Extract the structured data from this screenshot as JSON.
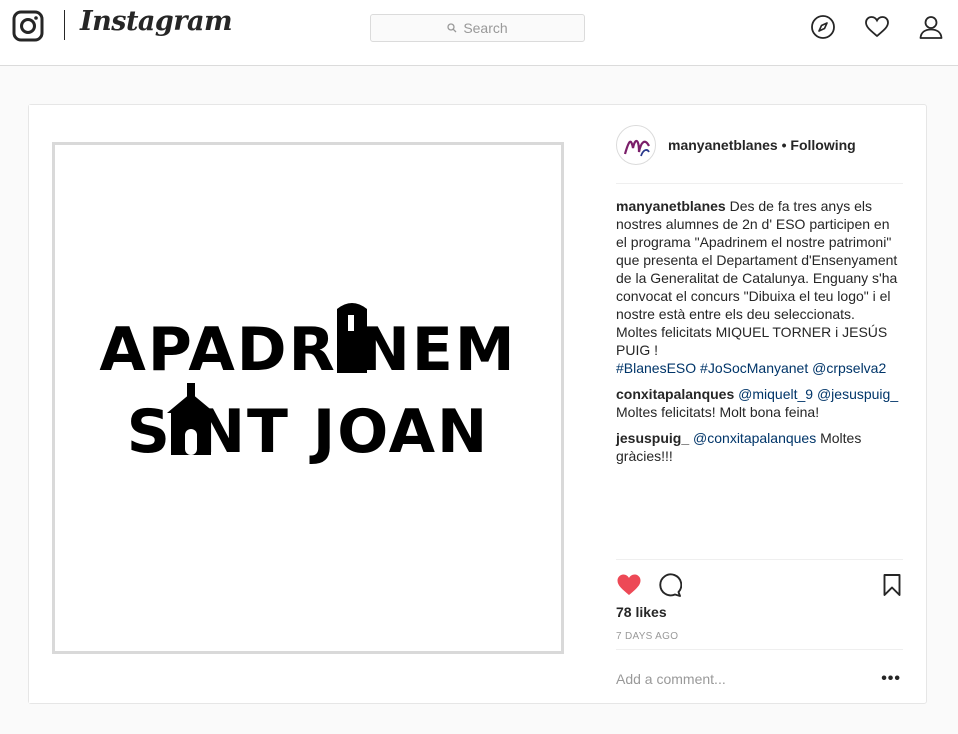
{
  "topbar": {
    "logo_icon": "instagram-camera-icon",
    "wordmark": "Instagram",
    "search_placeholder": "Search",
    "search_icon": "search-icon",
    "nav_icons": [
      "compass-icon",
      "heart-icon",
      "profile-icon"
    ]
  },
  "post": {
    "image_text": {
      "line1": "APADR NEM",
      "line2": "S NT JOAN"
    },
    "header": {
      "username": "manyanetblanes",
      "separator": " • ",
      "follow_status": "Following"
    },
    "caption": {
      "username": "manyanetblanes",
      "text": "Des de fa tres anys els nostres alumnes de 2n d' ESO participen en el programa \"Apadrinem el nostre patrimoni\" que presenta el Departament d'Ensenyament de la Generalitat de Catalunya. Enguany s'ha convocat el concurs \"Dibuixa el teu logo\" i el nostre està entre els deu seleccionats.",
      "text2": "Moltes felicitats MIQUEL TORNER i JESÚS PUIG !",
      "hashtags": "#BlanesESO #JoSocManyanet @crpselva2"
    },
    "comments": [
      {
        "username": "conxitapalanques",
        "mention": "@miquelt_9 @jesuspuig_",
        "text": "Moltes felicitats! Molt bona feina!"
      },
      {
        "username": "jesuspuig_",
        "mention": "@conxitapalanques",
        "text": "Moltes gràcies!!!"
      }
    ],
    "likes": "78 likes",
    "date": "7 DAYS AGO",
    "add_comment_placeholder": "Add a comment...",
    "more_label": "•••",
    "colors": {
      "like_red": "#ed4956",
      "link_blue": "#003569"
    }
  }
}
